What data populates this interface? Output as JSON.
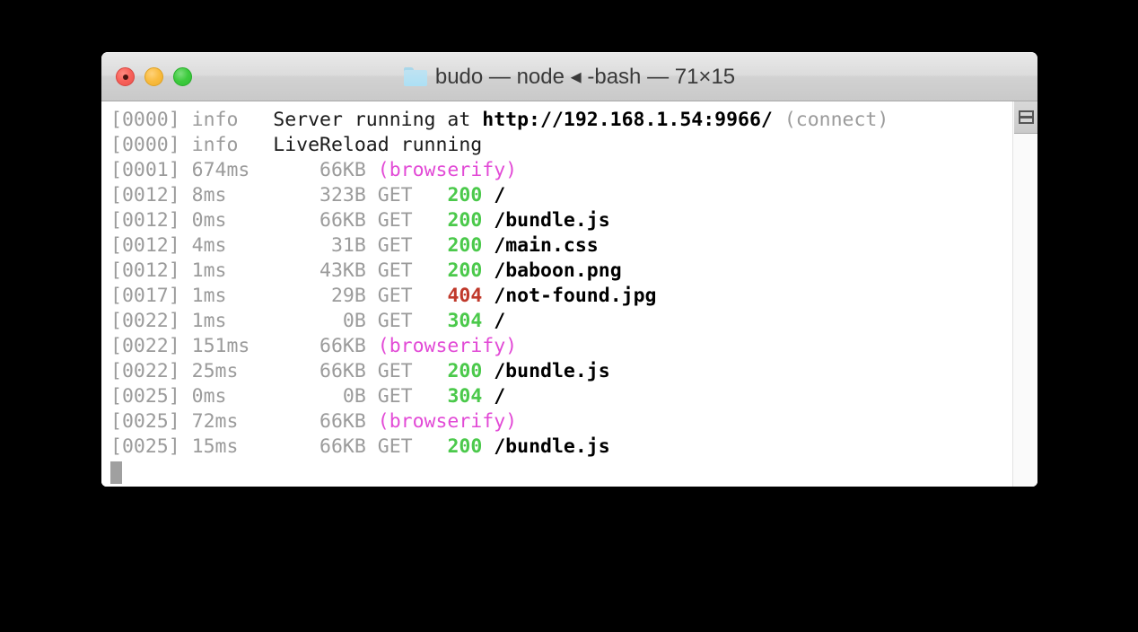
{
  "window": {
    "title": "budo — node ◂ -bash — 71×15",
    "folder_icon": "folder-icon",
    "traffic_lights": {
      "close_label": "Close",
      "minimize_label": "Minimize",
      "zoom_label": "Zoom"
    },
    "scrollbar": {
      "thumb_glyph": "lines-glyph"
    },
    "cursor": "block-cursor"
  },
  "terminal": {
    "lines": [
      {
        "time": "[0000]",
        "duration": "info ",
        "size": "",
        "method": "",
        "status": "",
        "message_plain": " Server running at ",
        "message_bold": "http://192.168.1.54:9966/",
        "message_dim": " (connect)",
        "raw": "[0000] info   Server running at http://192.168.1.54:9966/ (connect)"
      },
      {
        "time": "[0000]",
        "duration": "info ",
        "size": "",
        "method": "",
        "status": "",
        "message_plain": " LiveReload running",
        "message_bold": "",
        "message_dim": "",
        "raw": "[0000] info   LiveReload running"
      },
      {
        "time": "[0001]",
        "duration": "674ms",
        "size": "66KB",
        "method": "",
        "status": "",
        "label": "(browserify)",
        "raw": "[0001] 674ms      66KB (browserify)"
      },
      {
        "time": "[0012]",
        "duration": "8ms",
        "size": "323B",
        "method": "GET",
        "status": "200",
        "status_kind": "ok",
        "path": "/",
        "raw": "[0012] 8ms        323B GET   200 /"
      },
      {
        "time": "[0012]",
        "duration": "0ms",
        "size": "66KB",
        "method": "GET",
        "status": "200",
        "status_kind": "ok",
        "path": "/bundle.js",
        "raw": "[0012] 0ms        66KB GET   200 /bundle.js"
      },
      {
        "time": "[0012]",
        "duration": "4ms",
        "size": "31B",
        "method": "GET",
        "status": "200",
        "status_kind": "ok",
        "path": "/main.css",
        "raw": "[0012] 4ms         31B GET   200 /main.css"
      },
      {
        "time": "[0012]",
        "duration": "1ms",
        "size": "43KB",
        "method": "GET",
        "status": "200",
        "status_kind": "ok",
        "path": "/baboon.png",
        "raw": "[0012] 1ms        43KB GET   200 /baboon.png"
      },
      {
        "time": "[0017]",
        "duration": "1ms",
        "size": "29B",
        "method": "GET",
        "status": "404",
        "status_kind": "error",
        "path": "/not-found.jpg",
        "raw": "[0017] 1ms         29B GET   404 /not-found.jpg"
      },
      {
        "time": "[0022]",
        "duration": "1ms",
        "size": "0B",
        "method": "GET",
        "status": "304",
        "status_kind": "ok",
        "path": "/",
        "raw": "[0022] 1ms          0B GET   304 /"
      },
      {
        "time": "[0022]",
        "duration": "151ms",
        "size": "66KB",
        "method": "",
        "status": "",
        "label": "(browserify)",
        "raw": "[0022] 151ms      66KB (browserify)"
      },
      {
        "time": "[0022]",
        "duration": "25ms",
        "size": "66KB",
        "method": "GET",
        "status": "200",
        "status_kind": "ok",
        "path": "/bundle.js",
        "raw": "[0022] 25ms       66KB GET   200 /bundle.js"
      },
      {
        "time": "[0025]",
        "duration": "0ms",
        "size": "0B",
        "method": "GET",
        "status": "304",
        "status_kind": "ok",
        "path": "/",
        "raw": "[0025] 0ms          0B GET   304 /"
      },
      {
        "time": "[0025]",
        "duration": "72ms",
        "size": "66KB",
        "method": "",
        "status": "",
        "label": "(browserify)",
        "raw": "[0025] 72ms       66KB (browserify)"
      },
      {
        "time": "[0025]",
        "duration": "15ms",
        "size": "66KB",
        "method": "GET",
        "status": "200",
        "status_kind": "ok",
        "path": "/bundle.js",
        "raw": "[0025] 15ms       66KB GET   200 /bundle.js"
      }
    ]
  },
  "colors": {
    "background": "#000000",
    "terminal_bg": "#ffffff",
    "dim": "#9b9b9b",
    "text": "#1a1a1a",
    "status_ok": "#4bc94b",
    "status_error": "#c0392b",
    "label_magenta": "#e24ad6",
    "cursor": "#a0a0a0"
  }
}
